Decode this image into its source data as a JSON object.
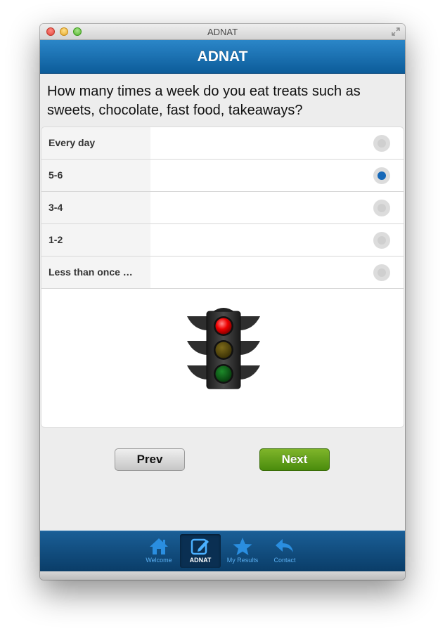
{
  "window": {
    "title": "ADNAT"
  },
  "header": {
    "title": "ADNAT"
  },
  "question": "How many times a week do you eat treats such as sweets, chocolate, fast food, takeaways?",
  "options": [
    {
      "label": "Every day",
      "checked": false
    },
    {
      "label": "5-6",
      "checked": true
    },
    {
      "label": "3-4",
      "checked": false
    },
    {
      "label": "1-2",
      "checked": false
    },
    {
      "label": "Less than once …",
      "checked": false
    }
  ],
  "traffic_light": {
    "icon": "traffic-light-icon",
    "active": "red"
  },
  "buttons": {
    "prev": "Prev",
    "next": "Next"
  },
  "tabs": [
    {
      "label": "Welcome",
      "icon": "home-icon",
      "active": false
    },
    {
      "label": "ADNAT",
      "icon": "edit-icon",
      "active": true
    },
    {
      "label": "My Results",
      "icon": "star-icon",
      "active": false
    },
    {
      "label": "Contact",
      "icon": "reply-arrow-icon",
      "active": false
    }
  ],
  "colors": {
    "header": "#1a72b5",
    "selected_radio": "#1668b8",
    "next_button": "#5f9e1a",
    "tab_label": "#5aaef0"
  }
}
